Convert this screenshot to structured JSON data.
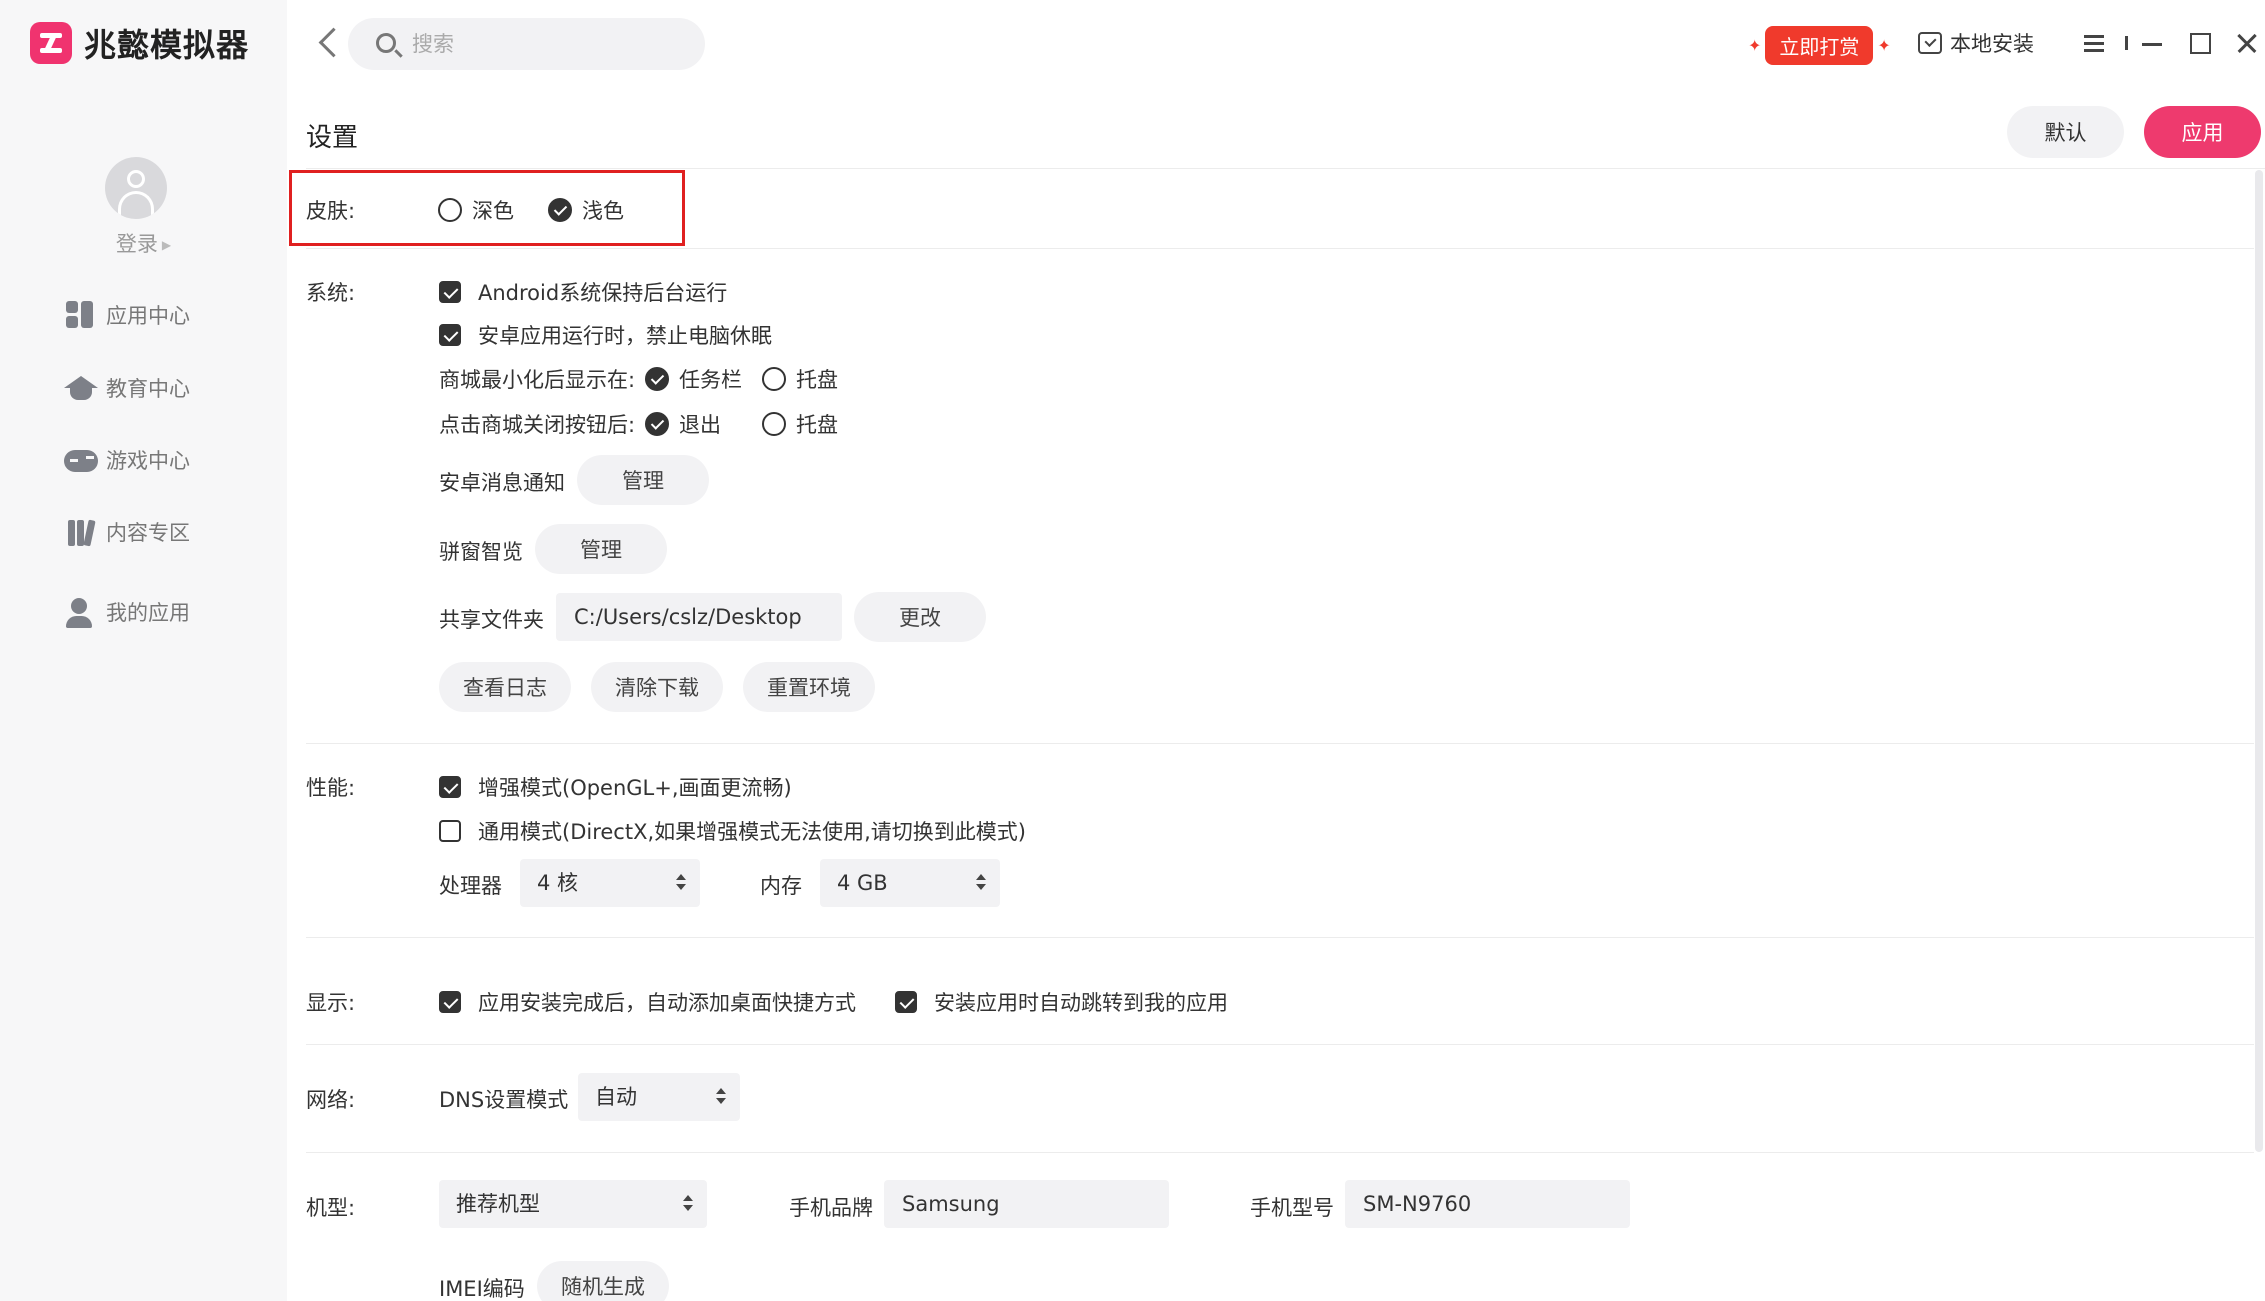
{
  "app": {
    "name": "兆懿模拟器"
  },
  "sidebar": {
    "login": "登录",
    "items": [
      {
        "label": "应用中心",
        "icon": "app-center-icon"
      },
      {
        "label": "教育中心",
        "icon": "education-icon"
      },
      {
        "label": "游戏中心",
        "icon": "gamepad-icon"
      },
      {
        "label": "内容专区",
        "icon": "books-icon"
      },
      {
        "label": "我的应用",
        "icon": "user-apps-icon"
      }
    ]
  },
  "topbar": {
    "search_placeholder": "搜索",
    "reward": "立即打赏",
    "local_install": "本地安装"
  },
  "header": {
    "title": "设置",
    "default_button": "默认",
    "apply_button": "应用"
  },
  "skin": {
    "label": "皮肤:",
    "options": [
      {
        "label": "深色",
        "selected": false
      },
      {
        "label": "浅色",
        "selected": true
      }
    ]
  },
  "system": {
    "label": "系统:",
    "keep_background": {
      "label": "Android系统保持后台运行",
      "checked": true
    },
    "prevent_sleep": {
      "label": "安卓应用运行时，禁止电脑休眠",
      "checked": true
    },
    "minimize_to": {
      "label": "商城最小化后显示在:",
      "options": [
        {
          "label": "任务栏",
          "selected": true
        },
        {
          "label": "托盘",
          "selected": false
        }
      ]
    },
    "close_action": {
      "label": "点击商城关闭按钮后:",
      "options": [
        {
          "label": "退出",
          "selected": true
        },
        {
          "label": "托盘",
          "selected": false
        }
      ]
    },
    "notification": {
      "label": "安卓消息通知",
      "button": "管理"
    },
    "smart_window": {
      "label": "骈窗智览",
      "button": "管理"
    },
    "shared_folder": {
      "label": "共享文件夹",
      "path": "C:/Users/cslz/Desktop",
      "button": "更改"
    },
    "actions": {
      "view_log": "查看日志",
      "clear_download": "清除下载",
      "reset_env": "重置环境"
    }
  },
  "performance": {
    "label": "性能:",
    "enhanced": {
      "label": "增强模式(OpenGL+,画面更流畅)",
      "checked": true
    },
    "general": {
      "label": "通用模式(DirectX,如果增强模式无法使用,请切换到此模式)",
      "checked": false
    },
    "cpu": {
      "label": "处理器",
      "value": "4 核"
    },
    "memory": {
      "label": "内存",
      "value": "4 GB"
    }
  },
  "display": {
    "label": "显示:",
    "shortcut": {
      "label": "应用安装完成后，自动添加桌面快捷方式",
      "checked": true
    },
    "jump": {
      "label": "安装应用时自动跳转到我的应用",
      "checked": true
    }
  },
  "network": {
    "label": "网络:",
    "dns_label": "DNS设置模式",
    "dns_value": "自动"
  },
  "device": {
    "label": "机型:",
    "model_select": "推荐机型",
    "brand_label": "手机品牌",
    "brand_value": "Samsung",
    "model_label": "手机型号",
    "model_value": "SM-N9760",
    "imei_label": "IMEI编码",
    "imei_button": "随机生成"
  },
  "colors": {
    "accent": "#ee3a6e",
    "reward": "#f03a2c",
    "highlight": "#e02020",
    "sidebar_bg": "#f7f7f8"
  }
}
